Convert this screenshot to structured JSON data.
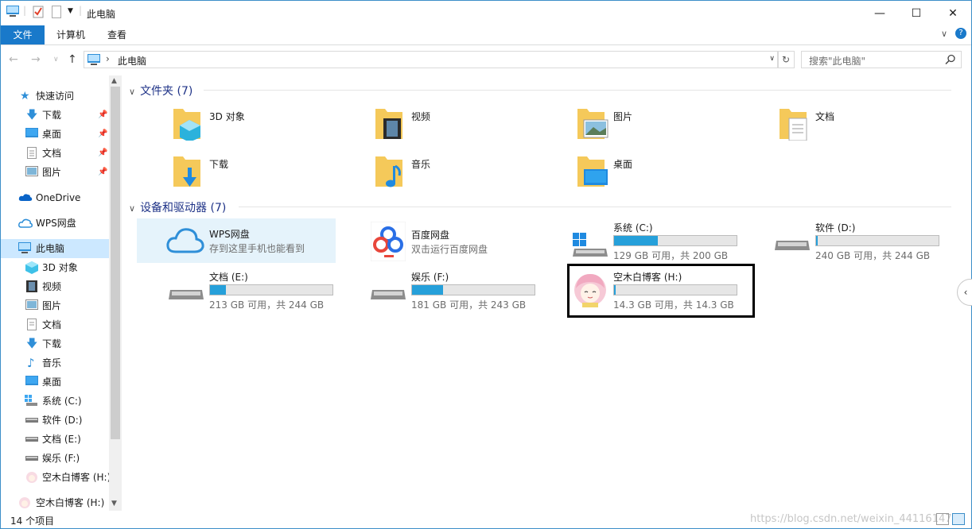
{
  "window": {
    "title": "此电脑",
    "controls": {
      "minimize": "—",
      "maximize": "☐",
      "close": "✕"
    }
  },
  "ribbon": {
    "tabs": [
      {
        "label": "文件",
        "active": true
      },
      {
        "label": "计算机",
        "active": false
      },
      {
        "label": "查看",
        "active": false
      }
    ]
  },
  "address": {
    "path": "此电脑",
    "search_placeholder": "搜索\"此电脑\""
  },
  "nav_pane": {
    "quick_access": "快速访问",
    "quick_items": [
      "下载",
      "桌面",
      "文档",
      "图片"
    ],
    "onedrive": "OneDrive",
    "wps": "WPS网盘",
    "this_pc": "此电脑",
    "pc_items": [
      "3D 对象",
      "视频",
      "图片",
      "文档",
      "下载",
      "音乐",
      "桌面",
      "系统 (C:)",
      "软件 (D:)",
      "文档 (E:)",
      "娱乐 (F:)",
      "空木白博客 (H:)"
    ],
    "usb": "空木白博客 (H:)"
  },
  "folders": {
    "header": "文件夹 (7)",
    "items": [
      "3D 对象",
      "视频",
      "图片",
      "文档",
      "下载",
      "音乐",
      "桌面"
    ]
  },
  "drives": {
    "header": "设备和驱动器 (7)",
    "wps": {
      "name": "WPS网盘",
      "desc": "存到这里手机也能看到"
    },
    "baidu": {
      "name": "百度网盘",
      "desc": "双击运行百度网盘"
    },
    "items": [
      {
        "name": "系统 (C:)",
        "info": "129 GB 可用，共 200 GB",
        "used_fraction": 0.355
      },
      {
        "name": "软件 (D:)",
        "info": "240 GB 可用，共 244 GB",
        "used_fraction": 0.016
      },
      {
        "name": "文档 (E:)",
        "info": "213 GB 可用，共 244 GB",
        "used_fraction": 0.127
      },
      {
        "name": "娱乐 (F:)",
        "info": "181 GB 可用，共 243 GB",
        "used_fraction": 0.255
      },
      {
        "name": "空木白博客 (H:)",
        "info": "14.3 GB 可用，共 14.3 GB",
        "used_fraction": 0.003
      }
    ]
  },
  "status": {
    "count": "14 个项目",
    "watermark": "https://blog.csdn.net/weixin_44116147"
  },
  "colors": {
    "accent": "#1979ca",
    "bar_fill": "#26a0da",
    "group_header": "#1e3287",
    "selection": "#cce8ff"
  }
}
